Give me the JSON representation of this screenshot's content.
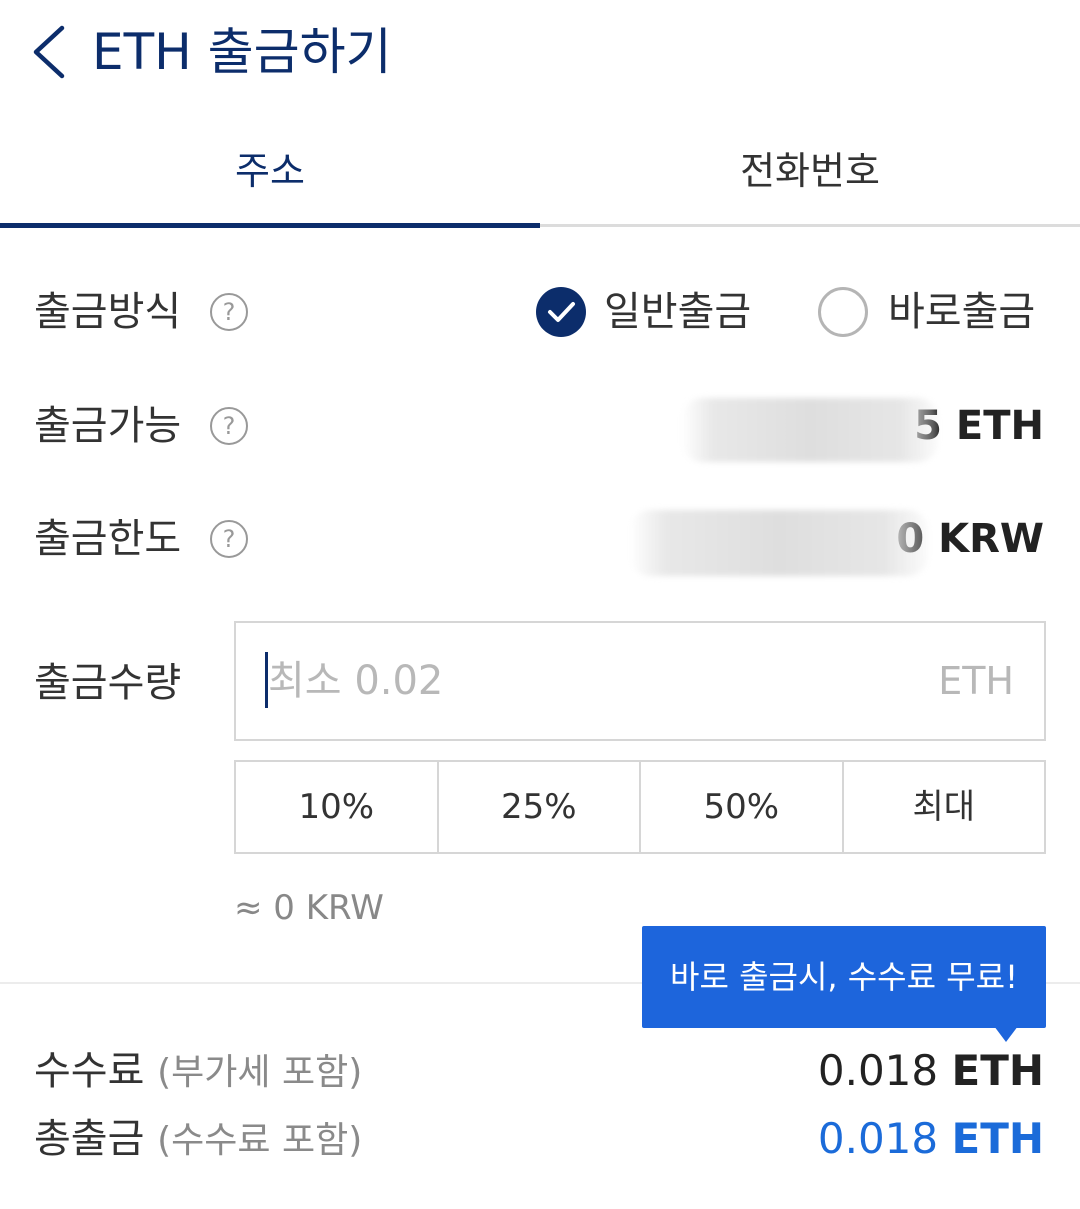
{
  "header": {
    "back_icon": "chevron-left-icon",
    "title": "ETH 출금하기"
  },
  "tabs": [
    {
      "label": "주소",
      "active": true
    },
    {
      "label": "전화번호",
      "active": false
    }
  ],
  "withdraw_method": {
    "label": "출금방식",
    "help_icon": "question-circle-icon",
    "options": [
      {
        "label": "일반출금",
        "selected": true
      },
      {
        "label": "바로출금",
        "selected": false
      }
    ]
  },
  "available": {
    "label": "출금가능",
    "value_suffix": "5 ETH"
  },
  "limit": {
    "label": "출금한도",
    "value_suffix": "0 KRW"
  },
  "amount": {
    "label": "출금수량",
    "value": "",
    "placeholder": "최소 0.02",
    "unit": "ETH",
    "presets": [
      "10%",
      "25%",
      "50%",
      "최대"
    ],
    "approx": "≈ 0 KRW"
  },
  "tooltip": {
    "text": "바로 출금시, 수수료 무료!"
  },
  "fee": {
    "label": "수수료",
    "sub": "(부가세 포함)",
    "amount": "0.018",
    "unit": "ETH"
  },
  "total": {
    "label": "총출금",
    "sub": "(수수료 포함)",
    "amount": "0.018",
    "unit": "ETH"
  },
  "colors": {
    "primary_navy": "#0c2d6b",
    "accent_blue": "#1b6bd9",
    "tooltip_blue": "#1d65dc"
  }
}
